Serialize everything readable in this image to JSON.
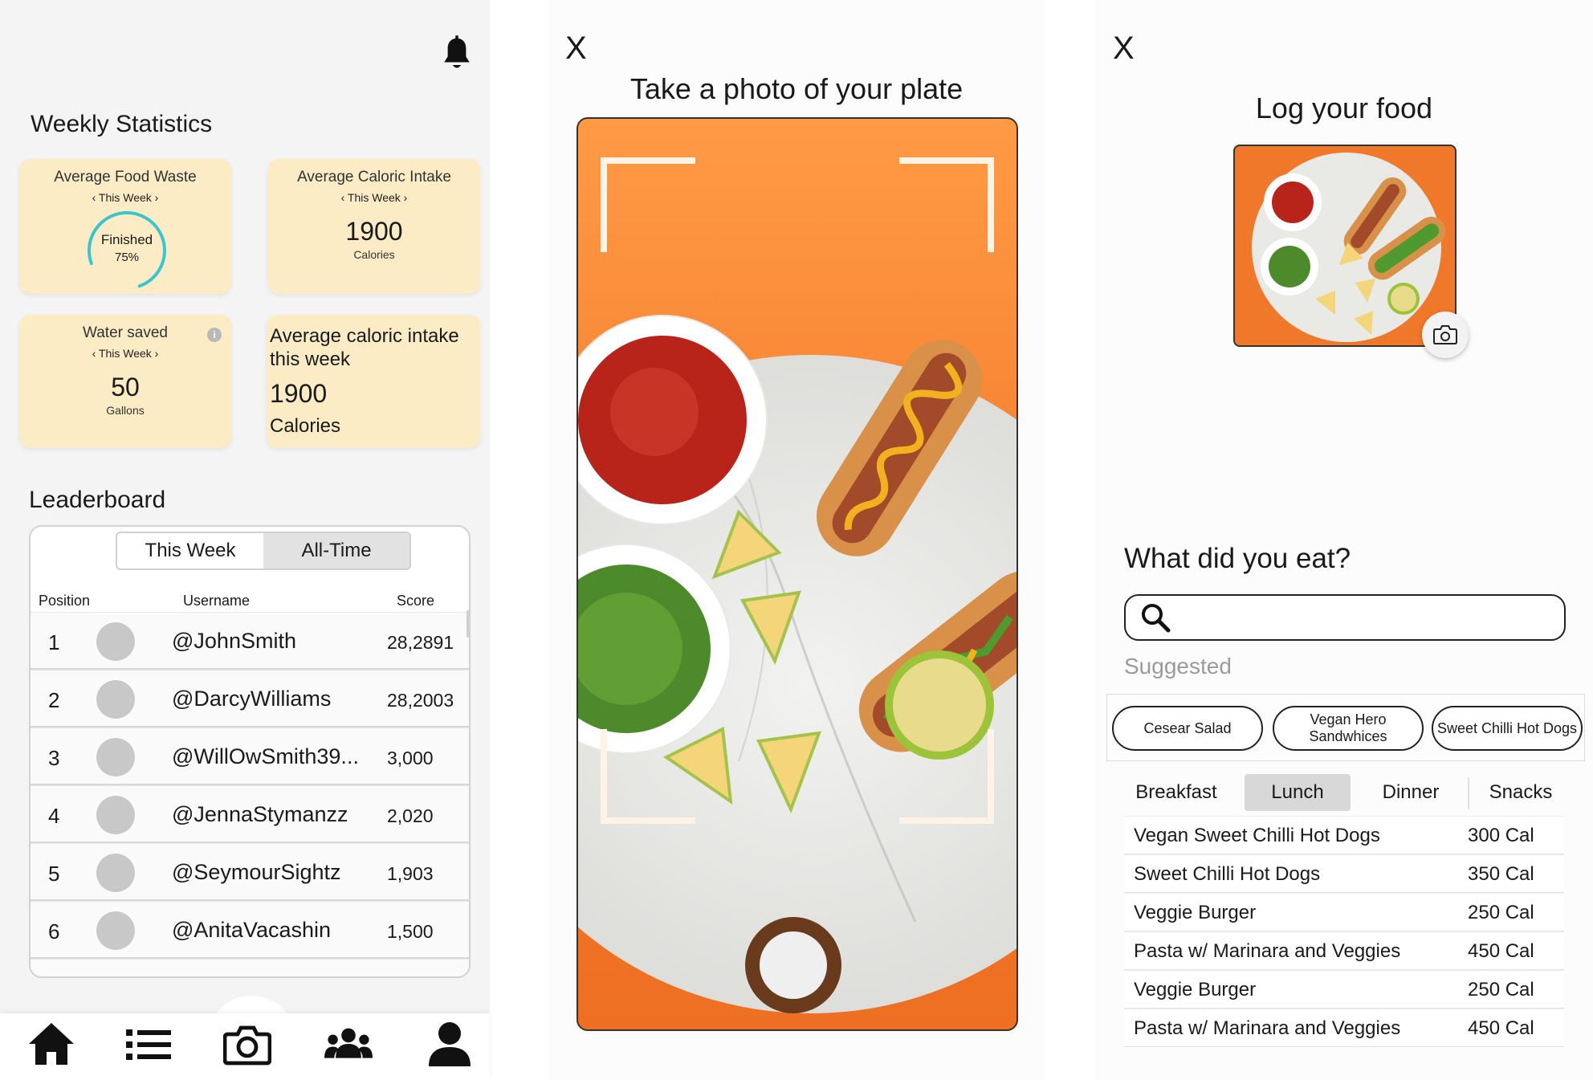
{
  "dashboard": {
    "title": "Weekly Statistics",
    "cards": {
      "food_waste": {
        "title": "Average Food Waste",
        "period": "‹ This Week ›",
        "ring_label": "Finished",
        "ring_value": "75%",
        "progress": 0.75
      },
      "caloric": {
        "title": "Average Caloric Intake",
        "period": "‹ This Week ›",
        "value": "1900",
        "unit": "Calories"
      },
      "water": {
        "title": "Water saved",
        "period": "‹ This Week ›",
        "value": "50",
        "unit": "Gallons",
        "info": "i"
      },
      "caloric_large": {
        "title": "Average caloric intake this week",
        "value": "1900",
        "unit": "Calories"
      }
    },
    "leaderboard": {
      "title": "Leaderboard",
      "tabs": [
        "This Week",
        "All-Time"
      ],
      "headers": {
        "position": "Position",
        "username": "Username",
        "score": "Score"
      },
      "rows": [
        {
          "pos": "1",
          "user": "@JohnSmith",
          "score": "28,2891"
        },
        {
          "pos": "2",
          "user": "@DarcyWilliams",
          "score": "28,2003"
        },
        {
          "pos": "3",
          "user": "@WillOwSmith39...",
          "score": "3,000"
        },
        {
          "pos": "4",
          "user": "@JennaStymanzz",
          "score": "2,020"
        },
        {
          "pos": "5",
          "user": "@SeymourSightz",
          "score": "1,903"
        },
        {
          "pos": "6",
          "user": "@AnitaVacashin",
          "score": "1,500"
        }
      ]
    },
    "nav": [
      "home-icon",
      "list-icon",
      "camera-icon",
      "group-icon",
      "profile-icon"
    ]
  },
  "camera": {
    "close": "X",
    "title": "Take a photo of your plate"
  },
  "log": {
    "close": "X",
    "title": "Log your food",
    "question": "What did you eat?",
    "suggested_label": "Suggested",
    "suggestions": [
      "Cesear Salad",
      "Vegan Hero Sandwhices",
      "Sweet Chilli Hot Dogs"
    ],
    "meal_tabs": [
      "Breakfast",
      "Lunch",
      "Dinner",
      "Snacks"
    ],
    "active_tab": "Lunch",
    "foods": [
      {
        "name": "Vegan Sweet Chilli Hot Dogs",
        "cal": "300 Cal"
      },
      {
        "name": "Sweet Chilli Hot Dogs",
        "cal": "350 Cal"
      },
      {
        "name": "Veggie Burger",
        "cal": "250 Cal"
      },
      {
        "name": "Pasta w/ Marinara and Veggies",
        "cal": "450 Cal"
      },
      {
        "name": "Veggie Burger",
        "cal": "250 Cal"
      },
      {
        "name": "Pasta w/ Marinara and Veggies",
        "cal": "450 Cal"
      }
    ]
  },
  "colors": {
    "card": "#fbecc5",
    "ring": "#3cc4d0",
    "orange": "#f47a2a",
    "shutter": "#6a3a1d"
  }
}
